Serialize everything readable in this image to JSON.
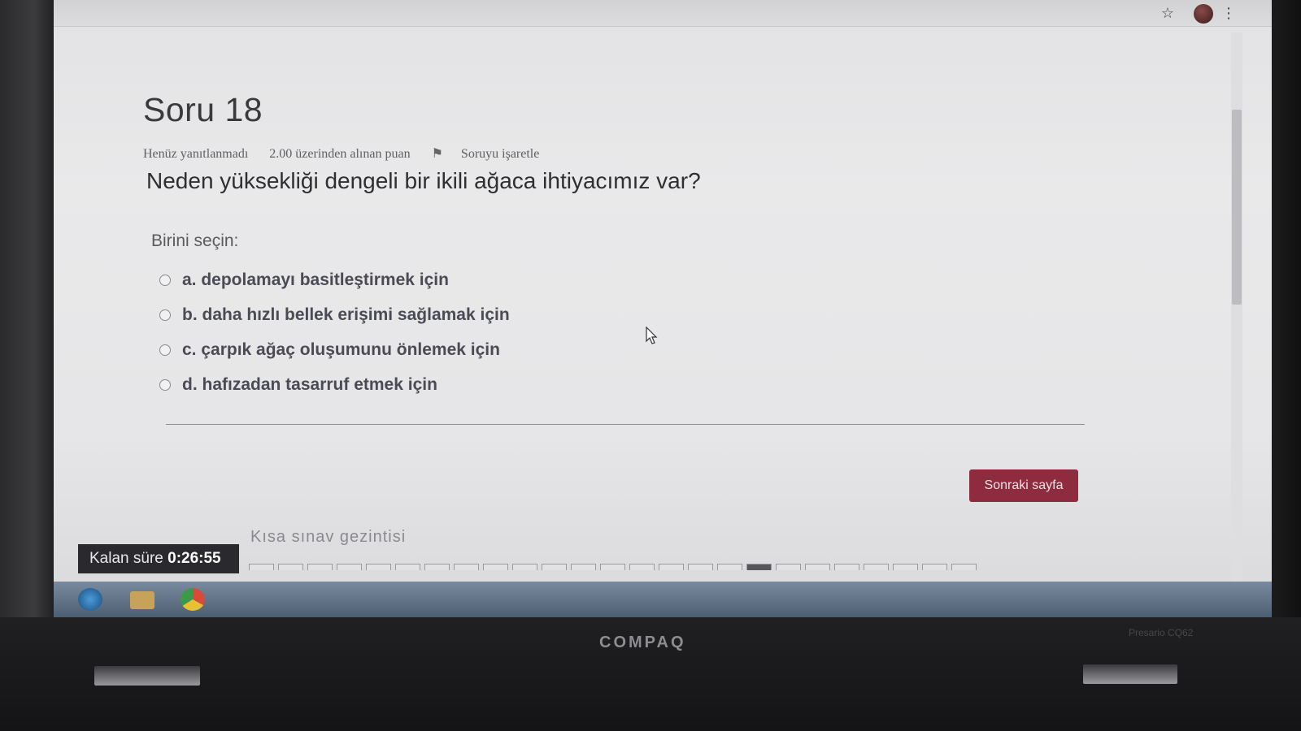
{
  "question": {
    "title": "Soru 18",
    "status": "Henüz yanıtlanmadı",
    "points": "2.00 üzerinden alınan puan",
    "flag_label": "Soruyu işaretle",
    "text": "Neden yüksekliği dengeli bir ikili ağaca ihtiyacımız var?",
    "prompt": "Birini seçin:",
    "options": [
      {
        "label": "a. depolamayı basitleştirmek için"
      },
      {
        "label": "b. daha hızlı bellek erişimi sağlamak için"
      },
      {
        "label": "c. çarpık ağaç oluşumunu önlemek için"
      },
      {
        "label": "d. hafızadan tasarruf etmek için"
      }
    ]
  },
  "navigation": {
    "next_label": "Sonraki sayfa",
    "quiz_nav_title": "Kısa sınav gezintisi"
  },
  "timer": {
    "label": "Kalan süre",
    "value": "0:26:55"
  },
  "device": {
    "brand": "COMPAQ",
    "model": "Presario CQ62"
  },
  "colors": {
    "accent": "#8e2b3e",
    "timer_bg": "#2a2a2e"
  },
  "icons": {
    "flag": "flag-icon",
    "star": "star-icon",
    "menu": "more-vert-icon"
  }
}
